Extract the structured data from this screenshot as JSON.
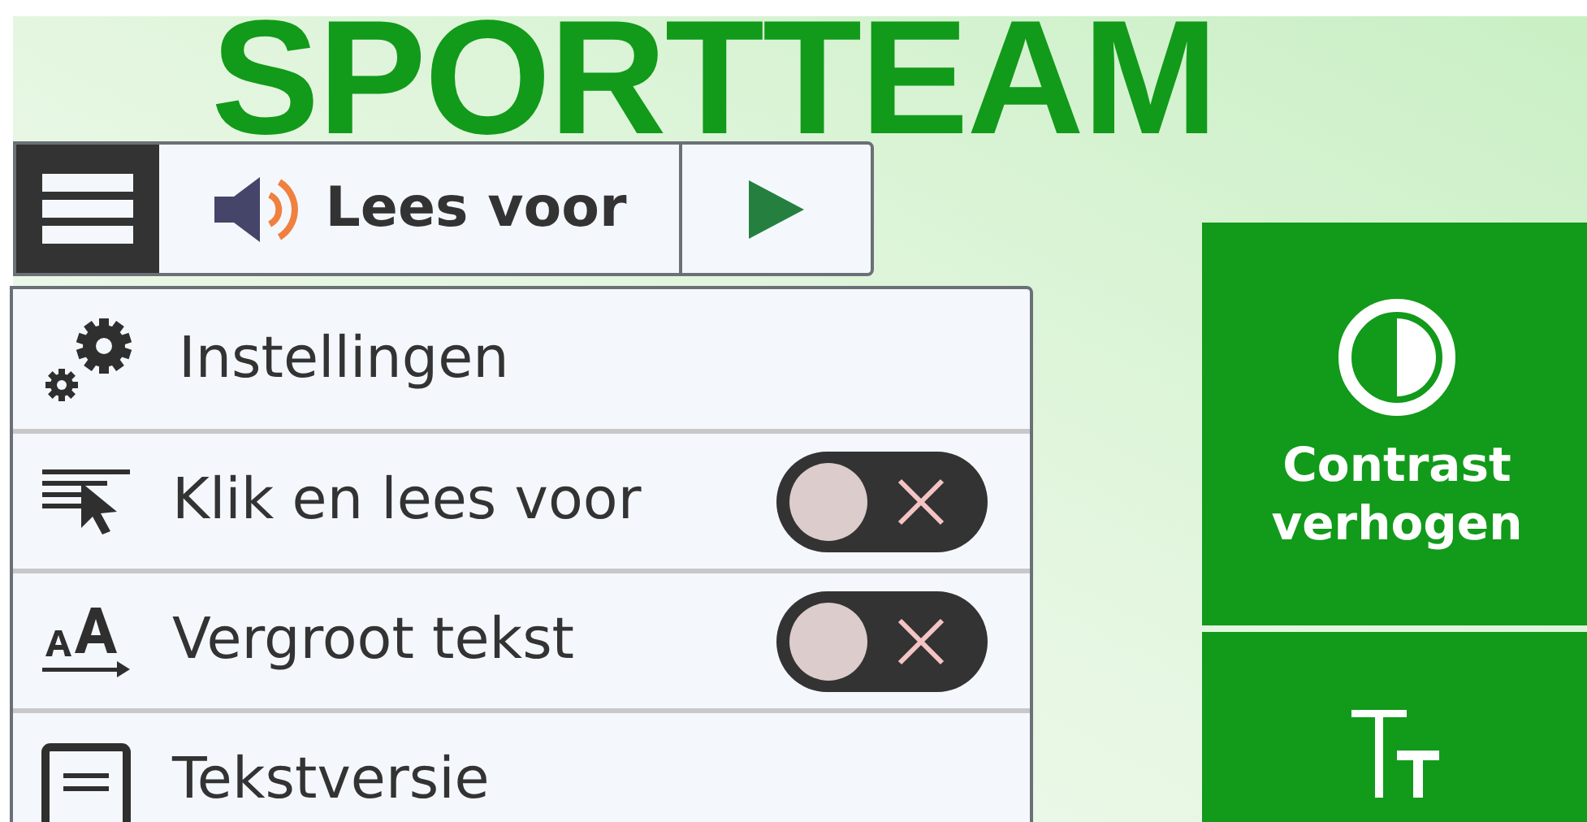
{
  "heading": "SPORTTEAM",
  "toolbar": {
    "read_aloud_label": "Lees voor"
  },
  "menu": {
    "items": [
      {
        "kind": "link",
        "label": "Instellingen"
      },
      {
        "kind": "toggle",
        "label": "Klik en lees voor",
        "checked": false
      },
      {
        "kind": "toggle",
        "label": "Vergroot tekst",
        "checked": false
      },
      {
        "kind": "link",
        "label": "Tekstversie"
      }
    ]
  },
  "side_panel": {
    "items": [
      {
        "kind": "contrast",
        "label": "Contrast verhogen"
      },
      {
        "kind": "text_size"
      }
    ]
  }
}
